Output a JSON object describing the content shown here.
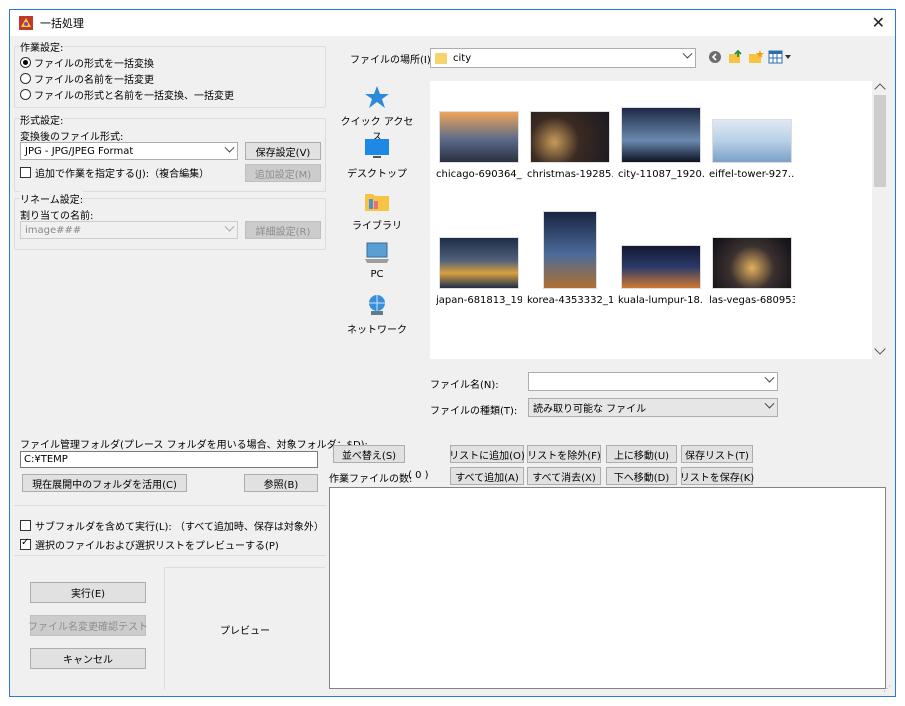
{
  "window": {
    "title": "一括処理",
    "close_label": "✕"
  },
  "operation": {
    "label": "作業設定:",
    "options": [
      {
        "label": "ファイルの形式を一括変換",
        "selected": true
      },
      {
        "label": "ファイルの名前を一括変更",
        "selected": false
      },
      {
        "label": "ファイルの形式と名前を一括変換、一括変更",
        "selected": false
      }
    ]
  },
  "format": {
    "label": "形式設定:",
    "target_label": "変換後のファイル形式:",
    "target_value": "JPG - JPG/JPEG Format",
    "save_settings_label": "保存設定(V)",
    "add_task_label": "追加で作業を指定する(J):（複合編集）",
    "add_task_checked": false,
    "add_settings_label": "追加設定(M)"
  },
  "rename": {
    "label": "リネーム設定:",
    "assign_label": "割り当ての名前:",
    "name_value": "image###",
    "detail_label": "詳細設定(R)"
  },
  "location": {
    "label": "ファイルの場所(I):",
    "folder": "city"
  },
  "places": [
    {
      "label": "クイック アクセス",
      "icon": "star-icon"
    },
    {
      "label": "デスクトップ",
      "icon": "desktop-icon"
    },
    {
      "label": "ライブラリ",
      "icon": "library-folder-icon"
    },
    {
      "label": "PC",
      "icon": "pc-icon"
    },
    {
      "label": "ネットワーク",
      "icon": "network-icon"
    }
  ],
  "files": [
    {
      "name": "chicago-690364_...",
      "colors": [
        "#f0a45a",
        "#5a6a8a",
        "#2a3040"
      ]
    },
    {
      "name": "christmas-19285...",
      "colors": [
        "#1a1a22",
        "#c89a5a",
        "#3a2a22"
      ]
    },
    {
      "name": "city-11087_1920....",
      "colors": [
        "#1e2a44",
        "#6a8ab0",
        "#0e1222"
      ]
    },
    {
      "name": "eiffel-tower-927...",
      "colors": [
        "#b8d0e8",
        "#7aa0c8",
        "#dfe8f2"
      ]
    },
    {
      "name": "japan-681813_19...",
      "colors": [
        "#1e2e48",
        "#d8a040",
        "#50607a"
      ]
    },
    {
      "name": "korea-4353332_1...",
      "colors": [
        "#1a2440",
        "#4a6a9a",
        "#b07030"
      ]
    },
    {
      "name": "kuala-lumpur-18...",
      "colors": [
        "#141830",
        "#d07a30",
        "#2a3a6a"
      ]
    },
    {
      "name": "las-vegas-680953...",
      "colors": [
        "#0e0e14",
        "#e0b060",
        "#3a3030"
      ]
    }
  ],
  "filename": {
    "label": "ファイル名(N):",
    "value": ""
  },
  "filetype": {
    "label": "ファイルの種類(T):",
    "value": "読み取り可能な ファイル"
  },
  "folder_mgmt": {
    "label": "ファイル管理フォルダ(プレース フォルダを用いる場合、対象フォルダ：$D):",
    "value": "C:¥TEMP",
    "use_current_label": "現在展開中のフォルダを活用(C)",
    "browse_label": "参照(B)"
  },
  "options": {
    "subfolder_label": "サブフォルダを含めて実行(L): （すべて追加時、保存は対象外）",
    "subfolder_checked": false,
    "preview_label": "選択のファイルおよび選択リストをプレビューする(P)",
    "preview_checked": true
  },
  "actions": {
    "run_label": "実行(E)",
    "rename_test_label": "ファイル名変更確認テスト",
    "cancel_label": "キャンセル",
    "preview_text": "プレビュー"
  },
  "list_buttons": {
    "sort": "並べ替え(S)",
    "add_to_list": "リストに追加(O)",
    "remove_from_list": "リストを除外(F)",
    "move_up": "上に移動(U)",
    "save_list_old": "保存リスト(T)",
    "add_all": "すべて追加(A)",
    "clear_all": "すべて消去(X)",
    "move_down": "下へ移動(D)",
    "save_list": "リストを保存(K)"
  },
  "worklist": {
    "count_label": "作業ファイルの数:",
    "count_value": "( 0 )"
  },
  "colors": {
    "accent": "#2b78d8",
    "folder": "#f6d36b"
  }
}
